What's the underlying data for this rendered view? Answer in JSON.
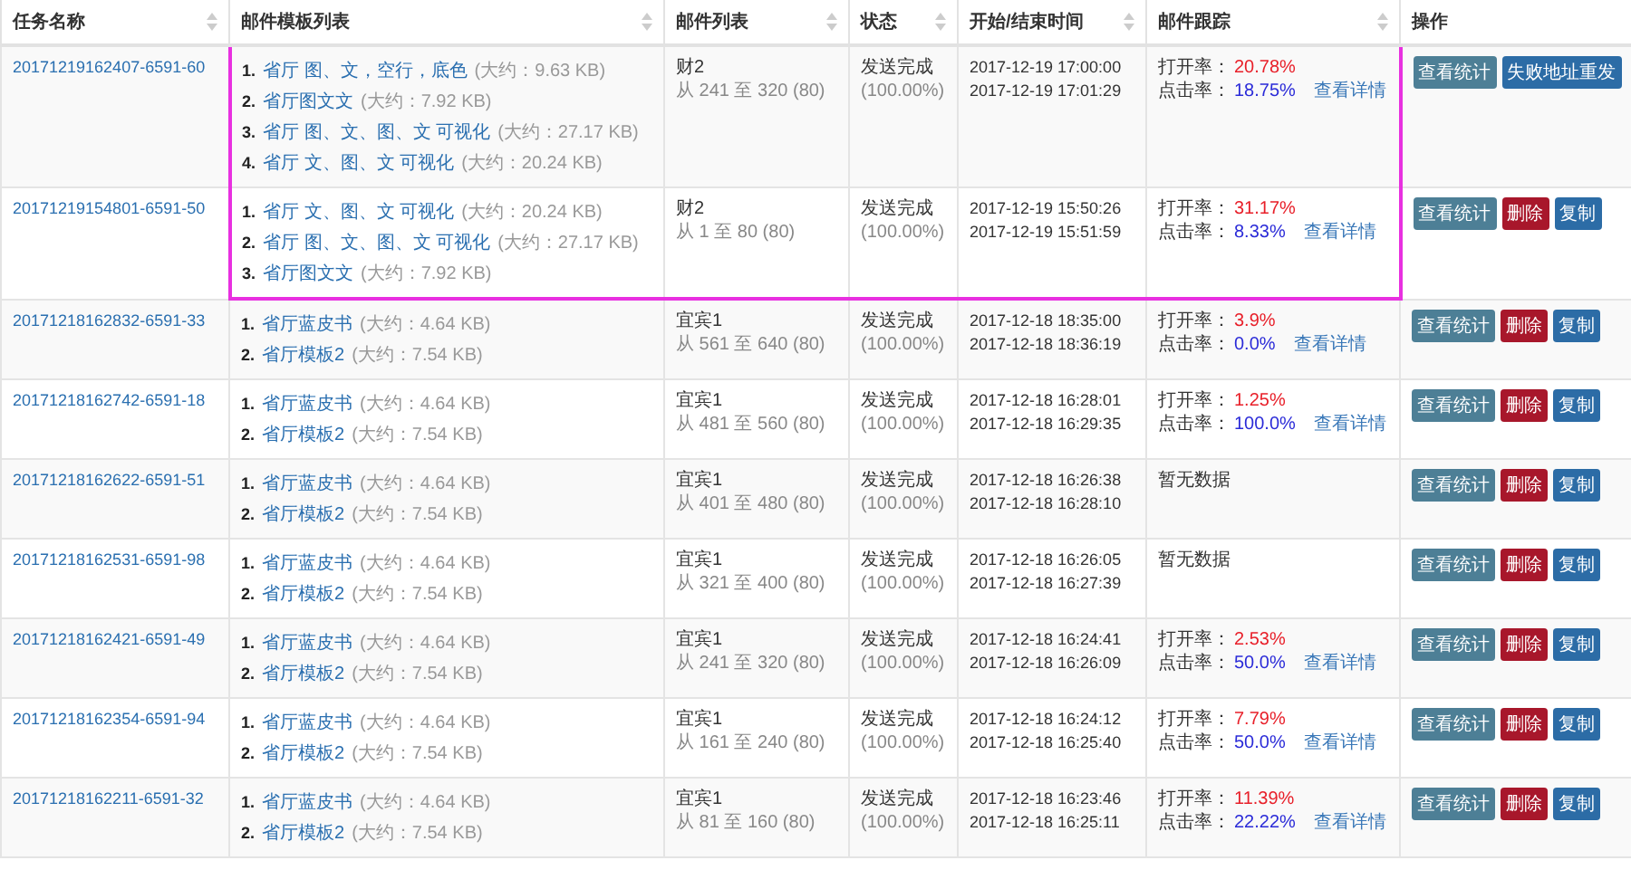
{
  "columns": [
    {
      "label": "任务名称",
      "sortable": true
    },
    {
      "label": "邮件模板列表",
      "sortable": true
    },
    {
      "label": "邮件列表",
      "sortable": true
    },
    {
      "label": "状态",
      "sortable": true
    },
    {
      "label": "开始/结束时间",
      "sortable": true
    },
    {
      "label": "邮件跟踪",
      "sortable": true
    },
    {
      "label": "操作",
      "sortable": false
    }
  ],
  "rows": [
    {
      "highlighted": true,
      "task": "20171219162407-6591-60",
      "templates": [
        {
          "num": "1.",
          "name": "省厅 图、文，空行，底色",
          "size": "(大约：9.63 KB)"
        },
        {
          "num": "2.",
          "name": "省厅图文文",
          "size": "(大约：7.92 KB)"
        },
        {
          "num": "3.",
          "name": "省厅 图、文、图、文 可视化",
          "size": "(大约：27.17 KB)"
        },
        {
          "num": "4.",
          "name": "省厅 文、图、文 可视化",
          "size": "(大约：20.24 KB)"
        }
      ],
      "list_name": "财2",
      "list_range": "从 241 至 320 (80)",
      "status": "发送完成",
      "progress": "(100.00%)",
      "start": "2017-12-19 17:00:00",
      "end": "2017-12-19 17:01:29",
      "tracking": {
        "kind": "rates",
        "open_label": "打开率：",
        "open": "20.78%",
        "click_label": "点击率：",
        "click": "18.75%",
        "link": "查看详情"
      },
      "actions": [
        {
          "kind": "stats",
          "label": "查看统计"
        },
        {
          "kind": "resend",
          "label": "失败地址重发"
        }
      ]
    },
    {
      "highlighted": true,
      "task": "20171219154801-6591-50",
      "templates": [
        {
          "num": "1.",
          "name": "省厅 文、图、文 可视化",
          "size": "(大约：20.24 KB)"
        },
        {
          "num": "2.",
          "name": "省厅 图、文、图、文 可视化",
          "size": "(大约：27.17 KB)"
        },
        {
          "num": "3.",
          "name": "省厅图文文",
          "size": "(大约：7.92 KB)"
        }
      ],
      "list_name": "财2",
      "list_range": "从 1 至 80 (80)",
      "status": "发送完成",
      "progress": "(100.00%)",
      "start": "2017-12-19 15:50:26",
      "end": "2017-12-19 15:51:59",
      "tracking": {
        "kind": "rates",
        "open_label": "打开率：",
        "open": "31.17%",
        "click_label": "点击率：",
        "click": "8.33%",
        "link": "查看详情"
      },
      "actions": [
        {
          "kind": "stats",
          "label": "查看统计"
        },
        {
          "kind": "delete",
          "label": "删除"
        },
        {
          "kind": "copy",
          "label": "复制"
        }
      ]
    },
    {
      "highlighted": false,
      "task": "20171218162832-6591-33",
      "templates": [
        {
          "num": "1.",
          "name": "省厅蓝皮书",
          "size": "(大约：4.64 KB)"
        },
        {
          "num": "2.",
          "name": "省厅模板2",
          "size": "(大约：7.54 KB)"
        }
      ],
      "list_name": "宜宾1",
      "list_range": "从 561 至 640 (80)",
      "status": "发送完成",
      "progress": "(100.00%)",
      "start": "2017-12-18 18:35:00",
      "end": "2017-12-18 18:36:19",
      "tracking": {
        "kind": "rates",
        "open_label": "打开率：",
        "open": "3.9%",
        "click_label": "点击率：",
        "click": "0.0%",
        "link": "查看详情"
      },
      "actions": [
        {
          "kind": "stats",
          "label": "查看统计"
        },
        {
          "kind": "delete",
          "label": "删除"
        },
        {
          "kind": "copy",
          "label": "复制"
        }
      ]
    },
    {
      "highlighted": false,
      "task": "20171218162742-6591-18",
      "templates": [
        {
          "num": "1.",
          "name": "省厅蓝皮书",
          "size": "(大约：4.64 KB)"
        },
        {
          "num": "2.",
          "name": "省厅模板2",
          "size": "(大约：7.54 KB)"
        }
      ],
      "list_name": "宜宾1",
      "list_range": "从 481 至 560 (80)",
      "status": "发送完成",
      "progress": "(100.00%)",
      "start": "2017-12-18 16:28:01",
      "end": "2017-12-18 16:29:35",
      "tracking": {
        "kind": "rates",
        "open_label": "打开率：",
        "open": "1.25%",
        "click_label": "点击率：",
        "click": "100.0%",
        "link": "查看详情"
      },
      "actions": [
        {
          "kind": "stats",
          "label": "查看统计"
        },
        {
          "kind": "delete",
          "label": "删除"
        },
        {
          "kind": "copy",
          "label": "复制"
        }
      ]
    },
    {
      "highlighted": false,
      "task": "20171218162622-6591-51",
      "templates": [
        {
          "num": "1.",
          "name": "省厅蓝皮书",
          "size": "(大约：4.64 KB)"
        },
        {
          "num": "2.",
          "name": "省厅模板2",
          "size": "(大约：7.54 KB)"
        }
      ],
      "list_name": "宜宾1",
      "list_range": "从 401 至 480 (80)",
      "status": "发送完成",
      "progress": "(100.00%)",
      "start": "2017-12-18 16:26:38",
      "end": "2017-12-18 16:28:10",
      "tracking": {
        "kind": "empty",
        "text": "暂无数据"
      },
      "actions": [
        {
          "kind": "stats",
          "label": "查看统计"
        },
        {
          "kind": "delete",
          "label": "删除"
        },
        {
          "kind": "copy",
          "label": "复制"
        }
      ]
    },
    {
      "highlighted": false,
      "task": "20171218162531-6591-98",
      "templates": [
        {
          "num": "1.",
          "name": "省厅蓝皮书",
          "size": "(大约：4.64 KB)"
        },
        {
          "num": "2.",
          "name": "省厅模板2",
          "size": "(大约：7.54 KB)"
        }
      ],
      "list_name": "宜宾1",
      "list_range": "从 321 至 400 (80)",
      "status": "发送完成",
      "progress": "(100.00%)",
      "start": "2017-12-18 16:26:05",
      "end": "2017-12-18 16:27:39",
      "tracking": {
        "kind": "empty",
        "text": "暂无数据"
      },
      "actions": [
        {
          "kind": "stats",
          "label": "查看统计"
        },
        {
          "kind": "delete",
          "label": "删除"
        },
        {
          "kind": "copy",
          "label": "复制"
        }
      ]
    },
    {
      "highlighted": false,
      "task": "20171218162421-6591-49",
      "templates": [
        {
          "num": "1.",
          "name": "省厅蓝皮书",
          "size": "(大约：4.64 KB)"
        },
        {
          "num": "2.",
          "name": "省厅模板2",
          "size": "(大约：7.54 KB)"
        }
      ],
      "list_name": "宜宾1",
      "list_range": "从 241 至 320 (80)",
      "status": "发送完成",
      "progress": "(100.00%)",
      "start": "2017-12-18 16:24:41",
      "end": "2017-12-18 16:26:09",
      "tracking": {
        "kind": "rates",
        "open_label": "打开率：",
        "open": "2.53%",
        "click_label": "点击率：",
        "click": "50.0%",
        "link": "查看详情"
      },
      "actions": [
        {
          "kind": "stats",
          "label": "查看统计"
        },
        {
          "kind": "delete",
          "label": "删除"
        },
        {
          "kind": "copy",
          "label": "复制"
        }
      ]
    },
    {
      "highlighted": false,
      "task": "20171218162354-6591-94",
      "templates": [
        {
          "num": "1.",
          "name": "省厅蓝皮书",
          "size": "(大约：4.64 KB)"
        },
        {
          "num": "2.",
          "name": "省厅模板2",
          "size": "(大约：7.54 KB)"
        }
      ],
      "list_name": "宜宾1",
      "list_range": "从 161 至 240 (80)",
      "status": "发送完成",
      "progress": "(100.00%)",
      "start": "2017-12-18 16:24:12",
      "end": "2017-12-18 16:25:40",
      "tracking": {
        "kind": "rates",
        "open_label": "打开率：",
        "open": "7.79%",
        "click_label": "点击率：",
        "click": "50.0%",
        "link": "查看详情"
      },
      "actions": [
        {
          "kind": "stats",
          "label": "查看统计"
        },
        {
          "kind": "delete",
          "label": "删除"
        },
        {
          "kind": "copy",
          "label": "复制"
        }
      ]
    },
    {
      "highlighted": false,
      "task": "20171218162211-6591-32",
      "templates": [
        {
          "num": "1.",
          "name": "省厅蓝皮书",
          "size": "(大约：4.64 KB)"
        },
        {
          "num": "2.",
          "name": "省厅模板2",
          "size": "(大约：7.54 KB)"
        }
      ],
      "list_name": "宜宾1",
      "list_range": "从 81 至 160 (80)",
      "status": "发送完成",
      "progress": "(100.00%)",
      "start": "2017-12-18 16:23:46",
      "end": "2017-12-18 16:25:11",
      "tracking": {
        "kind": "rates",
        "open_label": "打开率：",
        "open": "11.39%",
        "click_label": "点击率：",
        "click": "22.22%",
        "link": "查看详情"
      },
      "actions": [
        {
          "kind": "stats",
          "label": "查看统计"
        },
        {
          "kind": "delete",
          "label": "删除"
        },
        {
          "kind": "copy",
          "label": "复制"
        }
      ]
    }
  ]
}
